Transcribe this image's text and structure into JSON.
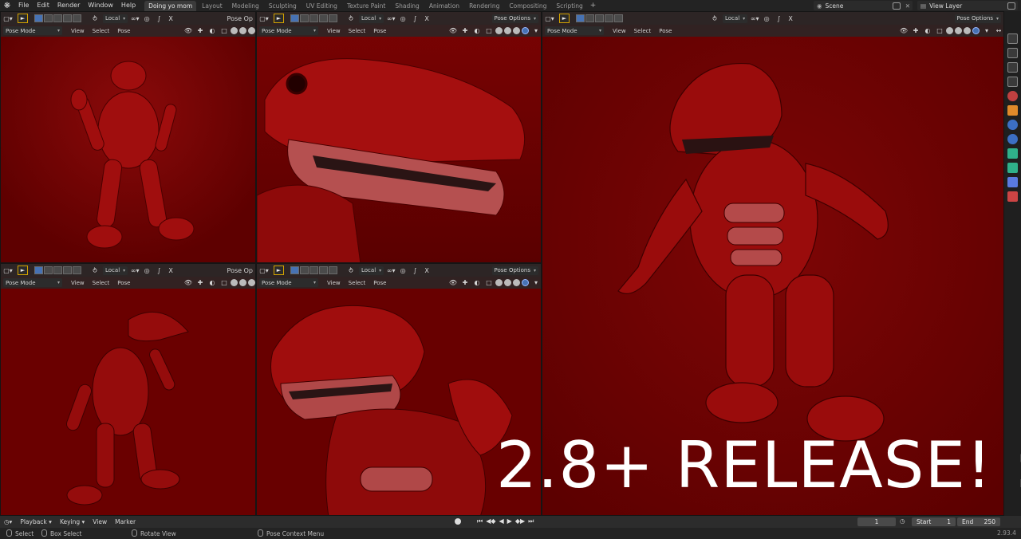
{
  "topbar": {
    "menus": [
      "File",
      "Edit",
      "Render",
      "Window",
      "Help"
    ],
    "workspace_tabs": [
      {
        "label": "Doing yo mom",
        "active": true
      },
      {
        "label": "Layout",
        "active": false
      },
      {
        "label": "Modeling",
        "active": false
      },
      {
        "label": "Sculpting",
        "active": false
      },
      {
        "label": "UV Editing",
        "active": false
      },
      {
        "label": "Texture Paint",
        "active": false
      },
      {
        "label": "Shading",
        "active": false
      },
      {
        "label": "Animation",
        "active": false
      },
      {
        "label": "Rendering",
        "active": false
      },
      {
        "label": "Compositing",
        "active": false
      },
      {
        "label": "Scripting",
        "active": false
      }
    ],
    "add_tab": "+",
    "scene": "Scene",
    "view_layer": "View Layer"
  },
  "viewport_header": {
    "orientation": "Local",
    "pose_options": "Pose Options",
    "pose_options_short": "Pose Op",
    "mode": "Pose Mode",
    "menus": [
      "View",
      "Select",
      "Pose"
    ],
    "close_x": "X"
  },
  "viewports": [
    {
      "id": "top-left"
    },
    {
      "id": "top-middle"
    },
    {
      "id": "bottom-left"
    },
    {
      "id": "bottom-middle"
    },
    {
      "id": "right-large"
    }
  ],
  "timeline": {
    "menus": [
      "Playback",
      "Keying",
      "View",
      "Marker"
    ],
    "current_frame": "1",
    "start_label": "Start",
    "start_value": "1",
    "end_label": "End",
    "end_value": "250"
  },
  "statusbar": {
    "select": "Select",
    "box_select": "Box Select",
    "rotate_view": "Rotate View",
    "context_menu": "Pose Context Menu",
    "version": "2.93.4"
  },
  "overlay_text": "2.8+ RELEASE! :)",
  "colors": {
    "viewport_bg": "#6c0000",
    "accent": "#4772b3",
    "tool_highlight": "#d4a300"
  }
}
